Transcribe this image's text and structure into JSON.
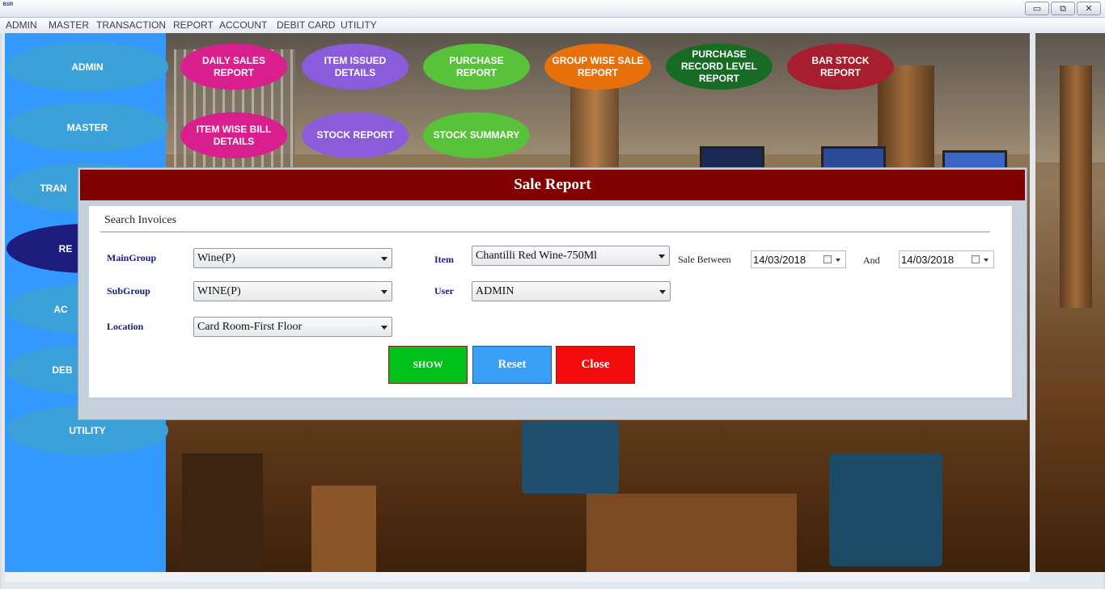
{
  "window": {
    "logo_text": "BSR",
    "minimize": "▭",
    "restore": "⧉",
    "close": "✕"
  },
  "menubar": [
    "ADMIN",
    "MASTER",
    "TRANSACTION",
    "REPORT",
    "ACCOUNT",
    "DEBIT CARD",
    "UTILITY"
  ],
  "sidebar": [
    {
      "label": "ADMIN"
    },
    {
      "label": "MASTER"
    },
    {
      "label": "TRAN"
    },
    {
      "label": "RE"
    },
    {
      "label": "AC"
    },
    {
      "label": "DEB"
    },
    {
      "label": "UTILITY"
    }
  ],
  "reports": [
    {
      "label": "DAILY SALES REPORT",
      "color": "#d91f8e"
    },
    {
      "label": "ITEM ISSUED DETAILS",
      "color": "#8a5cd9"
    },
    {
      "label": "PURCHASE REPORT",
      "color": "#58c23a"
    },
    {
      "label": "GROUP WISE SALE REPORT",
      "color": "#e8700a"
    },
    {
      "label": "PURCHASE RECORD LEVEL REPORT",
      "color": "#176b24"
    },
    {
      "label": "BAR STOCK REPORT",
      "color": "#a71f2f"
    },
    {
      "label": "ITEM WISE BILL DETAILS",
      "color": "#d91f8e"
    },
    {
      "label": "STOCK REPORT",
      "color": "#8a5cd9"
    },
    {
      "label": "STOCK SUMMARY",
      "color": "#58c23a"
    }
  ],
  "dialog": {
    "title": "Sale Report",
    "section": "Search Invoices",
    "fields": {
      "maingroup": {
        "label": "MainGroup",
        "value": "Wine(P)"
      },
      "subgroup": {
        "label": "SubGroup",
        "value": "WINE(P)"
      },
      "location": {
        "label": "Location",
        "value": "Card Room-First Floor"
      },
      "item": {
        "label": "Item",
        "value": "Chantilli Red Wine-750Ml"
      },
      "user": {
        "label": "User",
        "value": "ADMIN"
      },
      "sale_between": {
        "label": "Sale Between",
        "from": "14/03/2018"
      },
      "and": {
        "label": "And",
        "to": "14/03/2018"
      }
    },
    "buttons": {
      "show": {
        "label": "SHOW",
        "color": "#00c21a"
      },
      "reset": {
        "label": "Reset",
        "color": "#3aa0f6"
      },
      "close": {
        "label": "Close",
        "color": "#f40c0c"
      }
    }
  }
}
